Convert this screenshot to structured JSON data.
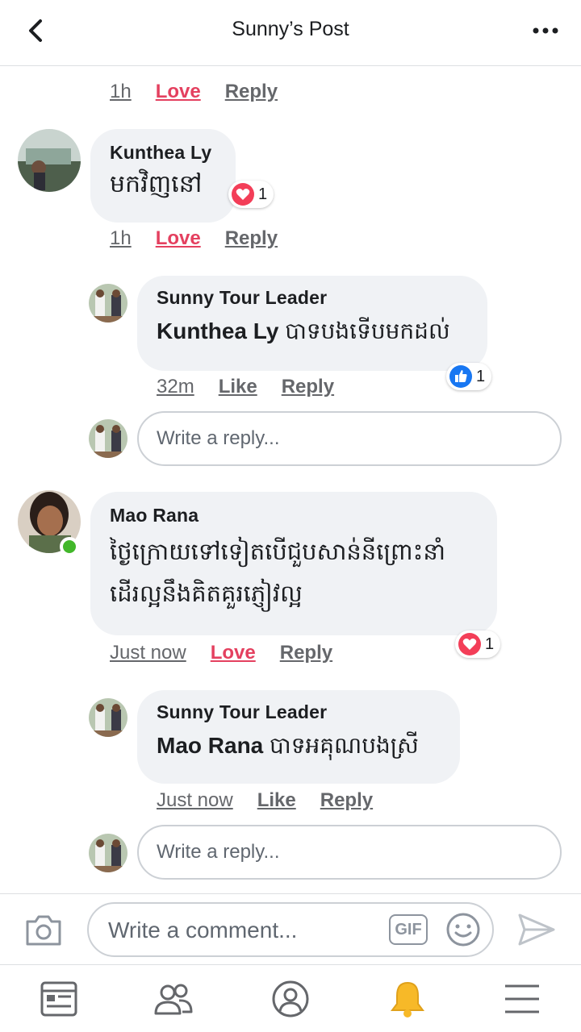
{
  "header": {
    "title": "Sunny’s Post"
  },
  "comments": [
    {
      "time": "1h",
      "reaction": "Love",
      "reply": "Reply"
    },
    {
      "author": "Kunthea Ly",
      "text": "មកវិញនៅ",
      "time": "1h",
      "reaction": "Love",
      "reply": "Reply",
      "react_count": "1"
    },
    {
      "author": "Sunny Tour Leader",
      "mention": "Kunthea Ly",
      "text": "បាទបងទើបមកដល់",
      "time": "32m",
      "reaction": "Like",
      "reply": "Reply",
      "react_count": "1"
    },
    {
      "author": "Mao Rana",
      "text_line1": "ថ្ងៃក្រោយទៅទៀតបើជួបសាន់នីព្រោះនាំ",
      "text_line2": "ដើរល្អនឹងគិតគួរភ្ញៀវល្អ",
      "time": "Just now",
      "reaction": "Love",
      "reply": "Reply",
      "react_count": "1"
    },
    {
      "author": "Sunny Tour Leader",
      "mention": "Mao Rana",
      "text": "បាទអគុណបងស្រី",
      "time": "Just now",
      "reaction": "Like",
      "reply": "Reply"
    }
  ],
  "reply_boxes": [
    {
      "placeholder": "Write a reply..."
    },
    {
      "placeholder": "Write a reply..."
    }
  ],
  "composer": {
    "placeholder": "Write a comment...",
    "gif_label": "GIF"
  },
  "colors": {
    "love": "#e4405f",
    "like": "#1877f2",
    "online": "#42b72a",
    "bell": "#f7b928"
  }
}
